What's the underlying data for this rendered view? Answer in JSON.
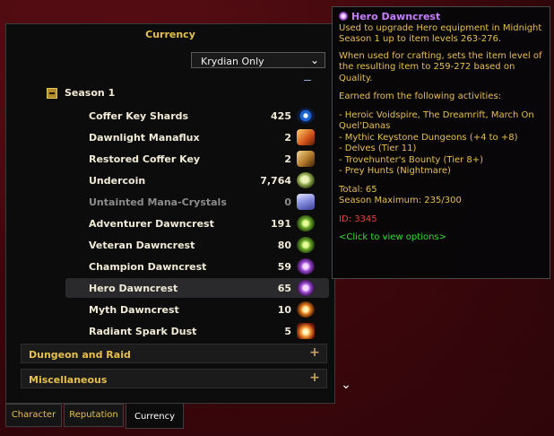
{
  "panel": {
    "title": "Currency",
    "filter_value": "Krydian Only",
    "season_label": "Season 1",
    "rows": [
      {
        "name": "Coffer Key Shards",
        "count": "425",
        "icon": "eye-icon"
      },
      {
        "name": "Dawnlight Manaflux",
        "count": "2",
        "icon": "flame-icon"
      },
      {
        "name": "Restored Coffer Key",
        "count": "2",
        "icon": "key-icon"
      },
      {
        "name": "Undercoin",
        "count": "7,764",
        "icon": "coin-icon"
      },
      {
        "name": "Untainted Mana-Crystals",
        "count": "0",
        "icon": "crystal-icon"
      },
      {
        "name": "Adventurer Dawncrest",
        "count": "191",
        "icon": "crest-green-icon"
      },
      {
        "name": "Veteran Dawncrest",
        "count": "80",
        "icon": "crest-green-icon"
      },
      {
        "name": "Champion Dawncrest",
        "count": "59",
        "icon": "crest-purple-icon"
      },
      {
        "name": "Hero Dawncrest",
        "count": "65",
        "icon": "crest-purple-icon"
      },
      {
        "name": "Myth Dawncrest",
        "count": "10",
        "icon": "crest-orange-icon"
      },
      {
        "name": "Radiant Spark Dust",
        "count": "5",
        "icon": "radiant-dust-icon"
      }
    ],
    "categories": [
      {
        "label": "Dungeon and Raid"
      },
      {
        "label": "Miscellaneous"
      }
    ]
  },
  "tabs": [
    "Character",
    "Reputation",
    "Currency"
  ],
  "tooltip": {
    "title": "Hero Dawncrest",
    "desc1": "Used to upgrade Hero equipment in Midnight Season 1 up to item levels 263-276.",
    "desc2": "When used for crafting, sets the item level of the resulting item to 259-272 based on Quality.",
    "earned_header": "Earned from the following activities:",
    "activities": [
      "- Heroic Voidspire, The Dreamrift, March On Quel'Danas",
      "- Mythic Keystone Dungeons (+4 to +8)",
      "- Delves (Tier 11)",
      "- Trovehunter's Bounty (Tier 8+)",
      "- Prey Hunts (Nightmare)"
    ],
    "total": "Total: 65",
    "season_max": "Season Maximum: 235/300",
    "id": "ID: 3345",
    "click_hint": "<Click to view options>"
  },
  "colors": {
    "gold": "#e6c04a",
    "epic_purple": "#c77dff",
    "id_red": "#e8403a",
    "hint_green": "#2ce02c"
  }
}
